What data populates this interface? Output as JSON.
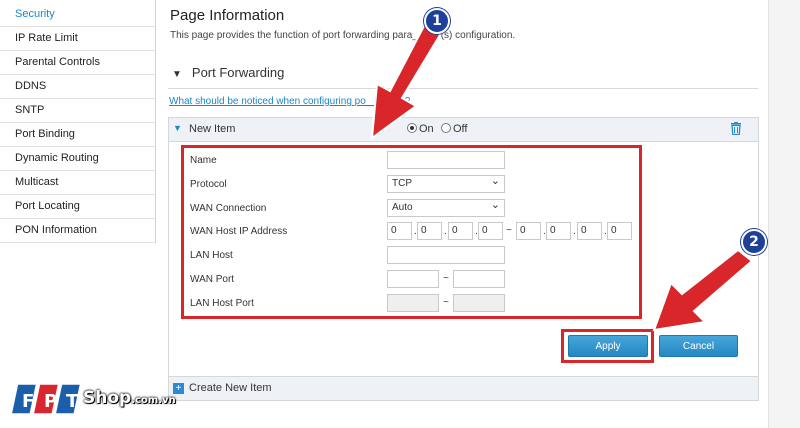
{
  "sidebar": {
    "items": [
      {
        "label": "Security",
        "active": true
      },
      {
        "label": "IP Rate Limit",
        "active": false
      },
      {
        "label": "Parental Controls",
        "active": false
      },
      {
        "label": "DDNS",
        "active": false
      },
      {
        "label": "SNTP",
        "active": false
      },
      {
        "label": "Port Binding",
        "active": false
      },
      {
        "label": "Dynamic Routing",
        "active": false
      },
      {
        "label": "Multicast",
        "active": false
      },
      {
        "label": "Port Locating",
        "active": false
      },
      {
        "label": "PON Information",
        "active": false
      }
    ]
  },
  "main": {
    "title": "Page Information",
    "description": "This page provides the function of port forwarding para__eter(s) configuration.",
    "section_title": "Port Forwarding",
    "notice_link": "What should be noticed when configuring po___rding?"
  },
  "item": {
    "title": "New Item",
    "radio_on": "On",
    "radio_off": "Off",
    "selected": "On"
  },
  "form": {
    "name_label": "Name",
    "name_value": "",
    "protocol_label": "Protocol",
    "protocol_value": "TCP",
    "wan_conn_label": "WAN Connection",
    "wan_conn_value": "Auto",
    "wan_ip_label": "WAN Host IP Address",
    "ip_start": [
      "0",
      "0",
      "0",
      "0"
    ],
    "ip_end": [
      "0",
      "0",
      "0",
      "0"
    ],
    "lan_host_label": "LAN Host",
    "lan_host_value": "",
    "wan_port_label": "WAN Port",
    "lan_host_port_label": "LAN Host Port",
    "separator": "~"
  },
  "buttons": {
    "apply": "Apply",
    "cancel": "Cancel"
  },
  "create_new": "Create New Item",
  "annotations": {
    "badge1": "1",
    "badge2": "2",
    "color": "#d8262a"
  },
  "logo": {
    "shop": "Shop",
    "domain": ".com.vn",
    "letters": [
      "F",
      "P",
      "T"
    ]
  },
  "colors": {
    "accent": "#1a87c8",
    "badge": "#1e3f9a",
    "logo_red": "#d7262d",
    "logo_blue": "#1b5eab"
  }
}
